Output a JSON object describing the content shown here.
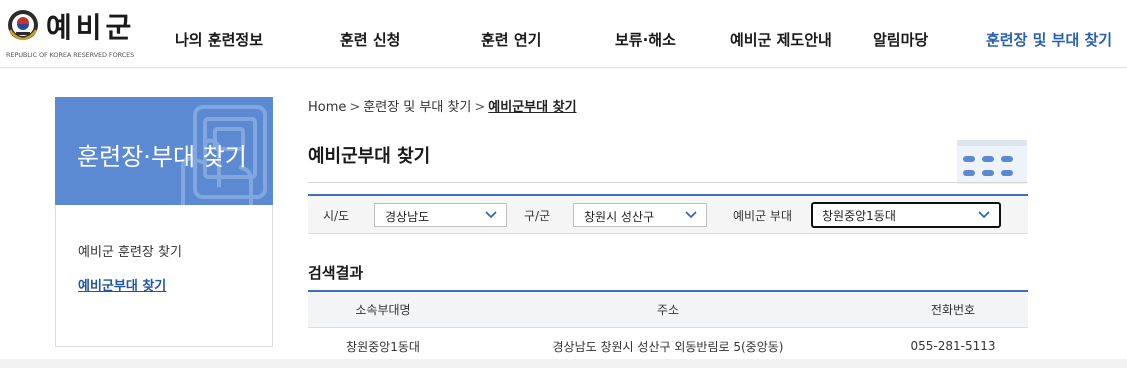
{
  "header": {
    "logo": {
      "title": "예비군",
      "subtitle": "REPUBLIC OF KOREA RESERVED FORCES"
    },
    "nav": [
      {
        "label": "나의 훈련정보",
        "active": false
      },
      {
        "label": "훈련 신청",
        "active": false
      },
      {
        "label": "훈련 연기",
        "active": false
      },
      {
        "label": "보류·해소",
        "active": false
      },
      {
        "label": "예비군 제도안내",
        "active": false
      },
      {
        "label": "알림마당",
        "active": false
      },
      {
        "label": "훈련장 및 부대 찾기",
        "active": true
      }
    ]
  },
  "sidebar": {
    "hero_title": "훈련장·부대 찾기",
    "items": [
      {
        "label": "예비군 훈련장 찾기",
        "active": false
      },
      {
        "label": "예비군부대 찾기",
        "active": true
      }
    ]
  },
  "breadcrumb": {
    "items": [
      "Home",
      "훈련장 및 부대 찾기",
      "예비군부대 찾기"
    ],
    "separator": ">"
  },
  "page": {
    "title": "예비군부대 찾기"
  },
  "filters": {
    "sido": {
      "label": "시/도",
      "value": "경상남도"
    },
    "gugun": {
      "label": "구/군",
      "value": "창원시 성산구"
    },
    "unit": {
      "label": "예비군 부대",
      "value": "창원중앙1동대"
    }
  },
  "results": {
    "title": "검색결과",
    "columns": [
      "소속부대명",
      "주소",
      "전화번호"
    ],
    "rows": [
      [
        "창원중앙1동대",
        "경상남도 창원시 성산구 외동반림로 5(중앙동)",
        "055-281-5113"
      ]
    ]
  },
  "colors": {
    "accent": "#3d6fc0",
    "sidebar_hero": "#5b8ad2",
    "active_nav": "#2a5fb8"
  }
}
